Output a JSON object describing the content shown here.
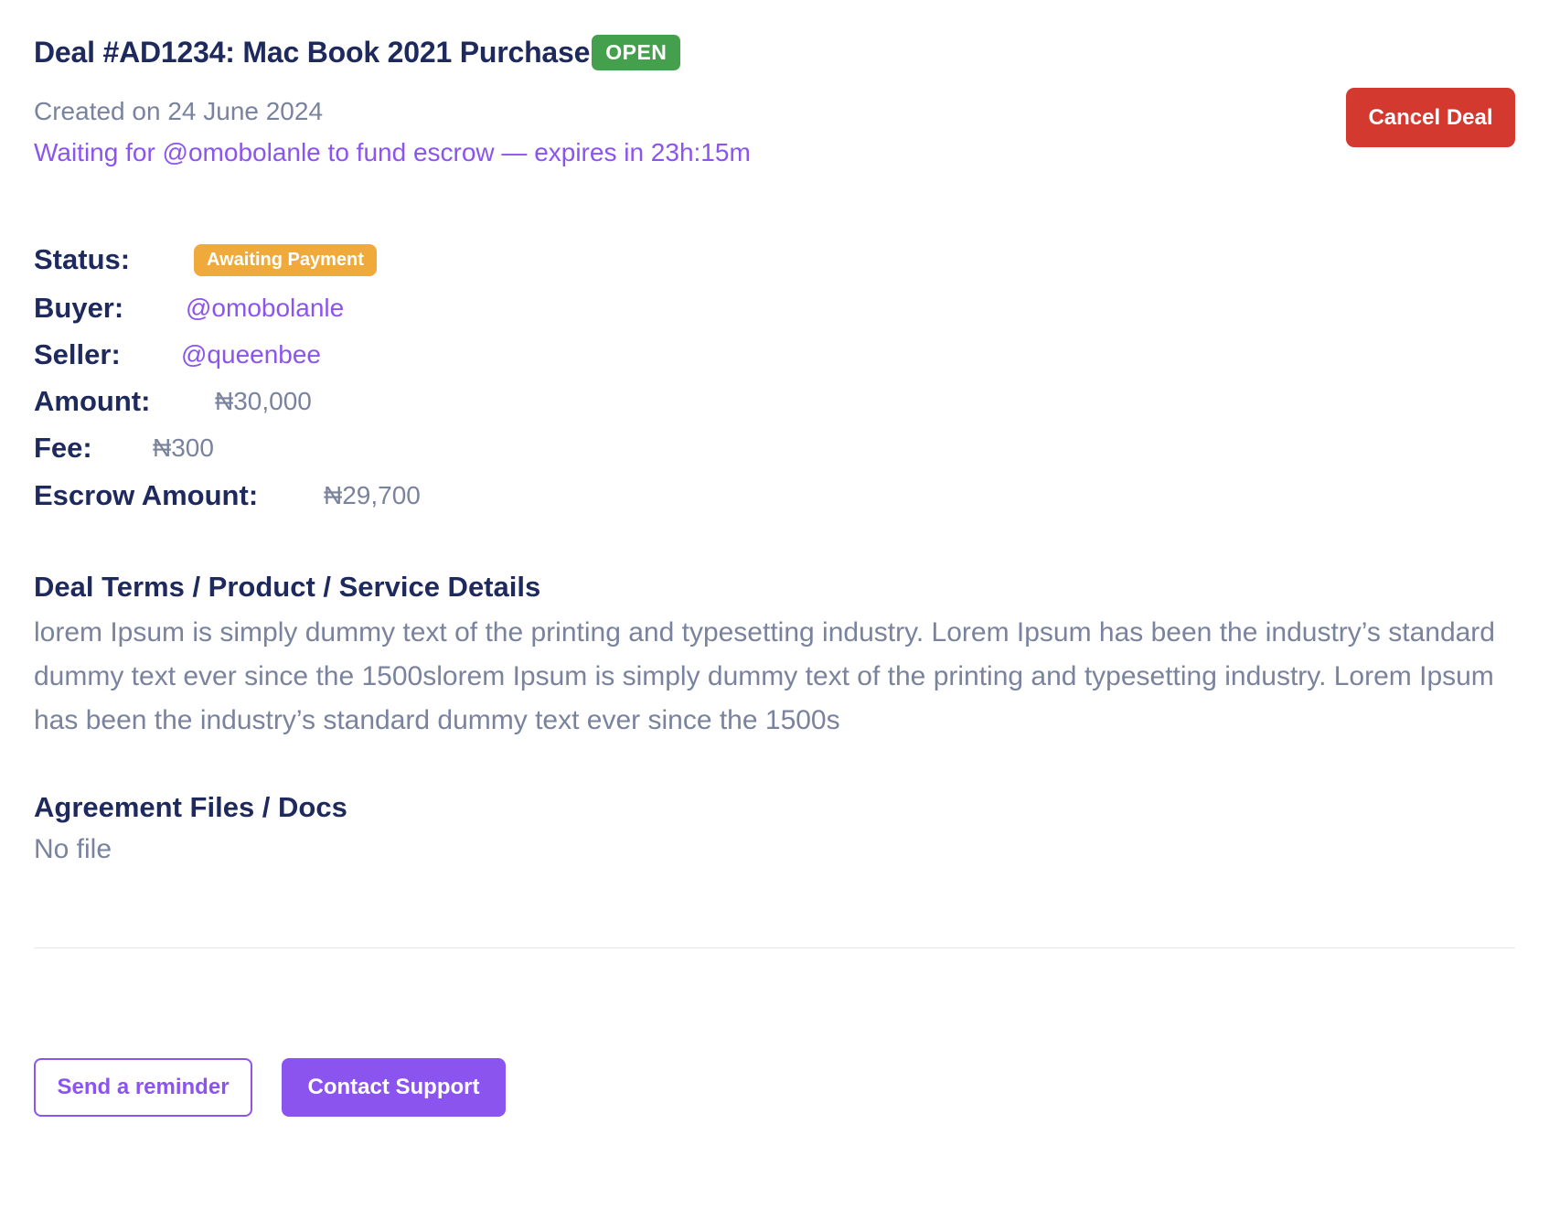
{
  "header": {
    "title": "Deal #AD1234: Mac Book 2021 Purchase",
    "badge": "OPEN",
    "created": "Created on 24 June 2024",
    "waiting": "Waiting for @omobolanle to fund escrow — expires in 23h:15m",
    "cancel_label": "Cancel Deal"
  },
  "details": {
    "status_label": "Status:",
    "status_value": "Awaiting Payment",
    "buyer_label": "Buyer:",
    "buyer_value": "@omobolanle",
    "seller_label": "Seller:",
    "seller_value": "@queenbee",
    "amount_label": "Amount:",
    "amount_value": "₦30,000",
    "fee_label": "Fee:",
    "fee_value": "₦300",
    "escrow_label": "Escrow Amount:",
    "escrow_value": "₦29,700"
  },
  "terms": {
    "heading": "Deal Terms / Product / Service Details",
    "body": "lorem Ipsum is simply dummy text of the printing and typesetting industry. Lorem Ipsum has been the industry’s standard dummy text ever since the 1500slorem Ipsum is simply dummy text of the printing and typesetting industry. Lorem Ipsum has been the industry’s standard dummy text ever since the 1500s"
  },
  "files": {
    "heading": "Agreement Files / Docs",
    "empty": "No file"
  },
  "actions": {
    "reminder_label": "Send a reminder",
    "support_label": "Contact Support"
  },
  "colors": {
    "primary": "#8c54ee",
    "open_badge": "#45a04d",
    "status_badge": "#f0aa3b",
    "danger": "#d3392f",
    "heading": "#1e2a5e",
    "muted": "#7a839e"
  }
}
